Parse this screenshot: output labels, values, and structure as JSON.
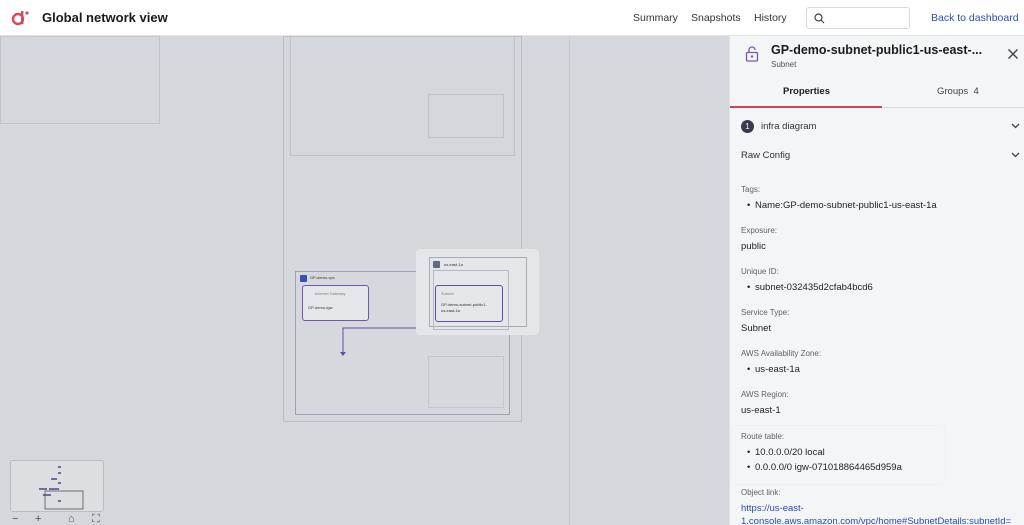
{
  "app": {
    "title": "Global network view",
    "nav": [
      "Summary",
      "Snapshots",
      "History"
    ],
    "search_placeholder": "",
    "back_link": "Back to dashboard",
    "accent_color": "#d8475a",
    "link_color": "#2b4fb3"
  },
  "panel": {
    "title": "GP-demo-subnet-public1-us-east-...",
    "subtitle": "Subnet",
    "tabs": [
      {
        "label": "Properties",
        "active": true
      },
      {
        "label": "Groups",
        "count": "4"
      }
    ],
    "accordions": [
      {
        "number": "1",
        "label": "infra diagram"
      },
      {
        "label": "Raw Config"
      }
    ],
    "fields": {
      "tags": {
        "label": "Tags:",
        "items": [
          "Name:GP-demo-subnet-public1-us-east-1a"
        ]
      },
      "exposure": {
        "label": "Exposure:",
        "value": "public"
      },
      "unique_id": {
        "label": "Unique ID:",
        "items": [
          "subnet-032435d2cfab4bcd6"
        ]
      },
      "service_type": {
        "label": "Service Type:",
        "value": "Subnet"
      },
      "az": {
        "label": "AWS Availability Zone:",
        "items": [
          "us-east-1a"
        ]
      },
      "region": {
        "label": "AWS Region:",
        "value": "us-east-1"
      },
      "route_table": {
        "label": "Route table:",
        "items": [
          "10.0.0.0/20 local",
          "0.0.0.0/0 igw-071018864465d959a"
        ]
      },
      "object_link": {
        "label": "Object link:",
        "lines": [
          "https://us-east-",
          "1.console.aws.amazon.com/vpc/home#SubnetDetails:subnetId="
        ]
      }
    }
  },
  "canvas": {
    "vpc_label": "GP-demo-vpc",
    "igw_header": "Internet Gateway",
    "igw_name": "GP-demo-igw",
    "az_label": "us-east-1a",
    "subnet_header": "Subnet",
    "subnet_name_lines": [
      "GP-demo-subnet-public1-",
      "us-east-1a"
    ],
    "zoom_controls": [
      "−",
      "+",
      "⌂",
      "⛶"
    ]
  }
}
